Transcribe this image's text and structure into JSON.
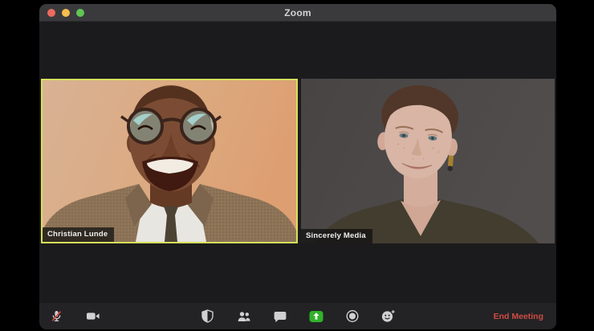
{
  "window": {
    "title": "Zoom",
    "traffic_lights": [
      {
        "name": "close",
        "color": "#ee6a5f"
      },
      {
        "name": "minimize",
        "color": "#f5bd4f"
      },
      {
        "name": "zoom",
        "color": "#61c554"
      }
    ]
  },
  "participants": [
    {
      "name": "Christian Lunde",
      "active_speaker": true,
      "border_color": "#d7e05c"
    },
    {
      "name": "Sincerely Media",
      "active_speaker": false
    }
  ],
  "toolbar": {
    "left_buttons": [
      {
        "id": "mute",
        "icon": "microphone-muted-icon",
        "state": "muted"
      },
      {
        "id": "video",
        "icon": "video-camera-icon",
        "state": "on"
      }
    ],
    "center_buttons": [
      {
        "id": "security",
        "icon": "shield-icon"
      },
      {
        "id": "participants",
        "icon": "participants-icon"
      },
      {
        "id": "chat",
        "icon": "chat-bubble-icon"
      },
      {
        "id": "share-screen",
        "icon": "share-screen-icon",
        "color": "#31b229"
      },
      {
        "id": "record",
        "icon": "record-icon"
      },
      {
        "id": "reactions",
        "icon": "reactions-smiley-icon"
      }
    ],
    "end_meeting_label": "End Meeting",
    "end_meeting_color": "#cf4b42"
  },
  "colors": {
    "desktop_bg": "#000000",
    "window_bg": "#1b1b1d",
    "titlebar_bg": "#3a3a3c",
    "toolbar_bg": "#232325",
    "active_speaker_border": "#d7e05c",
    "muted_mic_slash": "#d8453c"
  }
}
